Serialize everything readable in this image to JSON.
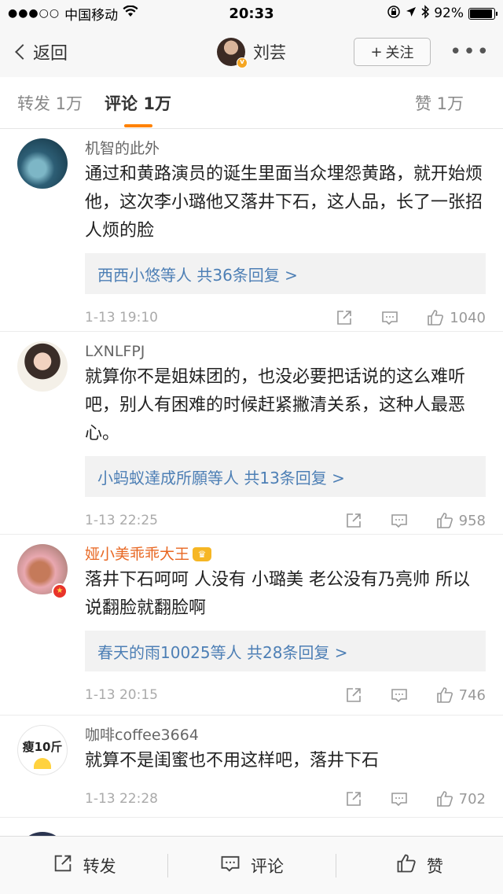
{
  "status": {
    "carrier": "中国移动",
    "time": "20:33",
    "battery": "92%",
    "battery_level": 0.92
  },
  "nav": {
    "back_label": "返回",
    "user_name": "刘芸",
    "verified_badge": "v",
    "follow_label": "关注",
    "more_label": "•••"
  },
  "tabs": {
    "repost": "转发 1万",
    "comment": "评论 1万",
    "like": "赞 1万"
  },
  "comments": [
    {
      "user": "机智的此外",
      "text": "通过和黄路演员的诞生里面当众埋怨黄路，就开始烦他，这次李小璐他又落井下石，这人品，长了一张招人烦的脸",
      "replies": "西西小悠等人  共36条回复 >",
      "time": "1-13 19:10",
      "likes": "1040"
    },
    {
      "user": "LXNLFPJ",
      "text": "就算你不是姐妹团的，也没必要把话说的这么难听吧，别人有困难的时候赶紧撇清关系，这种人最恶心。",
      "replies": "小蚂蚁達成所願等人  共13条回复 >",
      "time": "1-13 22:25",
      "likes": "958"
    },
    {
      "user": "娅小美乖乖大王",
      "text": "落井下石呵呵 人没有 小璐美 老公没有乃亮帅 所以说翻脸就翻脸啊",
      "replies": "春天的雨10025等人  共28条回复 >",
      "time": "1-13 20:15",
      "likes": "746"
    },
    {
      "user": "咖啡coffee3664",
      "avatar_text": "瘦10斤",
      "text": "就算不是闺蜜也不用这样吧，落井下石",
      "time": "1-13 22:28",
      "likes": "702"
    }
  ],
  "bottom": {
    "repost": "转发",
    "comment": "评论",
    "like": "赞"
  }
}
